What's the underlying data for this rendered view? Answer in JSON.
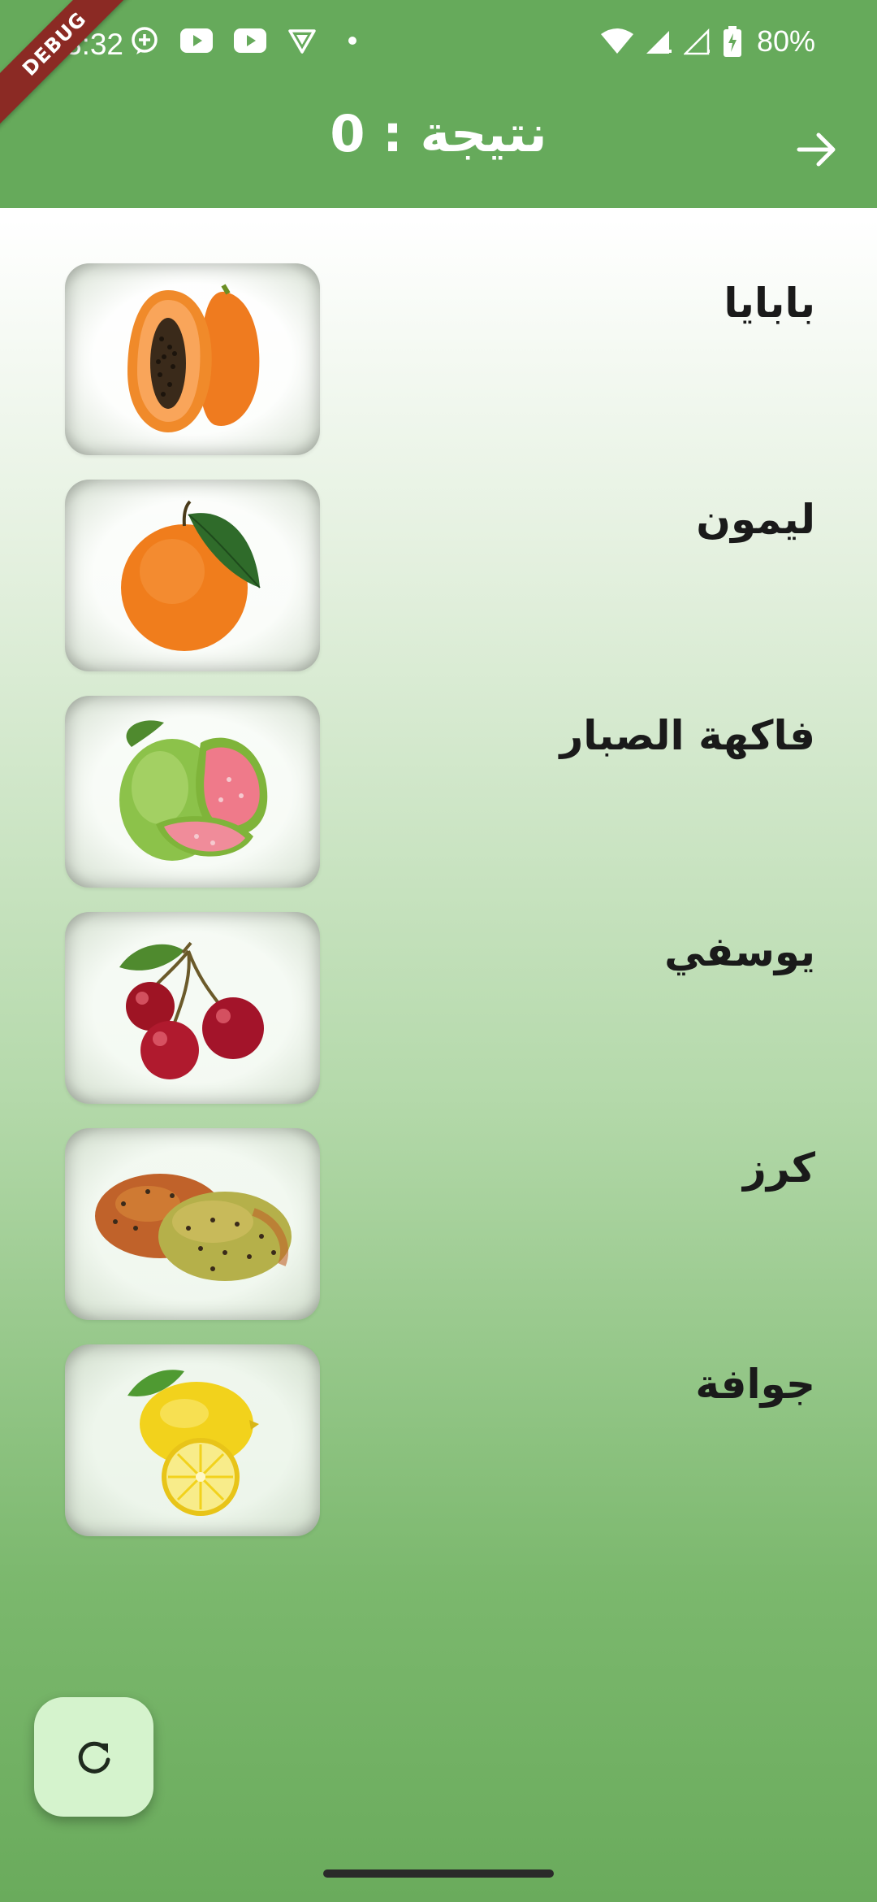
{
  "status_bar": {
    "time": "3:32",
    "battery": "80%",
    "icons": [
      "chat-bubble-icon",
      "youtube-icon",
      "youtube-icon",
      "vpn-shield-icon",
      "dot-icon",
      "wifi-icon",
      "signal-icon",
      "signal-icon",
      "battery-charging-icon"
    ]
  },
  "debug_banner": "DEBUG",
  "app_bar": {
    "title": "نتيجة : 0",
    "action_icon": "arrow-right-icon"
  },
  "fruits": [
    {
      "name": "بابايا",
      "image": "papaya"
    },
    {
      "name": "ليمون",
      "image": "orange"
    },
    {
      "name": "فاكهة الصبار",
      "image": "guava"
    },
    {
      "name": "يوسفي",
      "image": "cherries"
    },
    {
      "name": "كرز",
      "image": "prickly-pear"
    },
    {
      "name": "جوافة",
      "image": "lemon"
    }
  ],
  "fab": {
    "icon": "refresh-icon"
  },
  "colors": {
    "app_bar": "#66aa5b",
    "fab_background": "#d5f3cd",
    "debug_ribbon": "#8b2a24"
  }
}
